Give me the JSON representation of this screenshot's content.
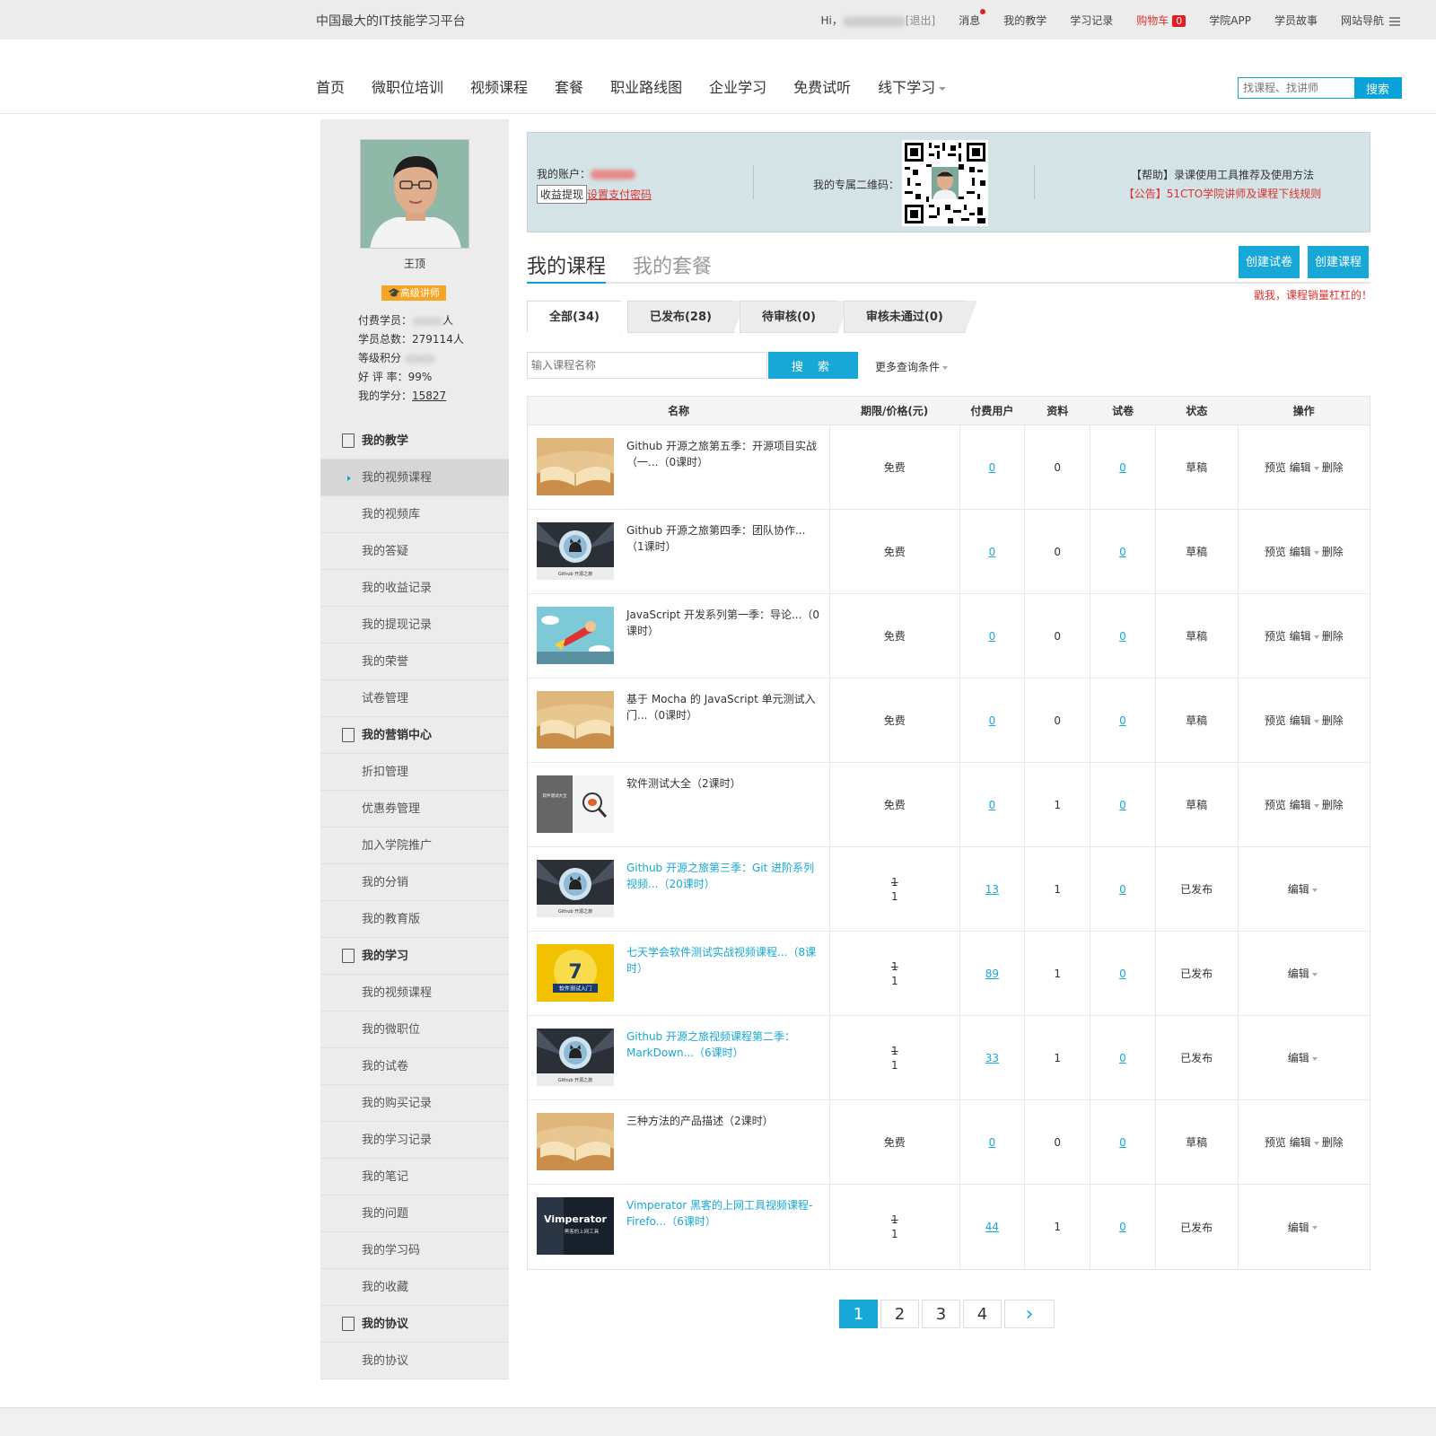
{
  "topbar": {
    "slogan": "中国最大的IT技能学习平台",
    "greeting": "Hi，",
    "logout": "[退出]",
    "links": [
      "消息",
      "我的教学",
      "学习记录"
    ],
    "cart_label": "购物车",
    "cart_count": "0",
    "links2": [
      "学院APP",
      "学员故事"
    ],
    "site_nav": "网站导航"
  },
  "nav": {
    "items": [
      "首页",
      "微职位培训",
      "视频课程",
      "套餐",
      "职业路线图",
      "企业学习",
      "免费试听",
      "线下学习"
    ],
    "search_placeholder": "找课程、找讲师",
    "search_button": "搜索"
  },
  "profile": {
    "name": "王顶",
    "level": "高级讲师",
    "paid_students_label": "付费学员：",
    "paid_students_suffix": "人",
    "total_students_label": "学员总数：",
    "total_students": "279114人",
    "points_label": "等级积分",
    "rating_label": "好 评 率：",
    "rating": "99%",
    "credits_label": "我的学分：",
    "credits": "15827"
  },
  "sidebar": {
    "sections": [
      {
        "title": "我的教学",
        "icon": "book-icon",
        "items": [
          "我的视频课程",
          "我的视频库",
          "我的答疑",
          "我的收益记录",
          "我的提现记录",
          "我的荣誉",
          "试卷管理"
        ]
      },
      {
        "title": "我的营销中心",
        "icon": "sale-tag-icon",
        "items": [
          "折扣管理",
          "优惠券管理",
          "加入学院推广",
          "我的分销",
          "我的教育版"
        ]
      },
      {
        "title": "我的学习",
        "icon": "clipboard-icon",
        "items": [
          "我的视频课程",
          "我的微职位",
          "我的试卷",
          "我的购买记录",
          "我的学习记录",
          "我的笔记",
          "我的问题",
          "我的学习码",
          "我的收藏"
        ]
      },
      {
        "title": "我的协议",
        "icon": "document-icon",
        "items": [
          "我的协议"
        ]
      }
    ]
  },
  "account": {
    "account_label": "我的账户：",
    "withdraw": "收益提现",
    "set_password": "设置支付密码",
    "qr_label": "我的专属二维码：",
    "help": "【帮助】录课使用工具推荐及使用方法",
    "notice": "【公告】51CTO学院讲师及课程下线规则"
  },
  "main": {
    "tabs": [
      "我的课程",
      "我的套餐"
    ],
    "create_exam": "创建试卷",
    "create_course": "创建课程",
    "promo": "戳我，课程销量杠杠的！",
    "subtabs": [
      "全部(34)",
      "已发布(28)",
      "待审核(0)",
      "审核未通过(0)"
    ],
    "search_placeholder": "输入课程名称",
    "search_button": "搜 索",
    "more": "更多查询条件"
  },
  "table": {
    "headers": [
      "名称",
      "期限/价格(元)",
      "付费用户",
      "资料",
      "试卷",
      "状态",
      "操作"
    ],
    "rows": [
      {
        "title": "Github 开源之旅第五季：开源项目实战（一...（0课时）",
        "thumb": "book",
        "published": false,
        "price": "免费",
        "paid": "0",
        "res": "0",
        "exam": "0",
        "status": "草稿"
      },
      {
        "title": "Github 开源之旅第四季：团队协作...（1课时）",
        "thumb": "github",
        "published": false,
        "price": "免费",
        "paid": "0",
        "res": "0",
        "exam": "0",
        "status": "草稿"
      },
      {
        "title": "JavaScript 开发系列第一季：导论...（0课时）",
        "thumb": "hero",
        "published": false,
        "price": "免费",
        "paid": "0",
        "res": "0",
        "exam": "0",
        "status": "草稿"
      },
      {
        "title": "基于 Mocha 的 JavaScript 单元测试入门...（0课时）",
        "thumb": "book",
        "published": false,
        "price": "免费",
        "paid": "0",
        "res": "0",
        "exam": "0",
        "status": "草稿"
      },
      {
        "title": "软件测试大全（2课时）",
        "thumb": "test",
        "published": false,
        "price": "免费",
        "paid": "0",
        "res": "1",
        "exam": "0",
        "status": "草稿"
      },
      {
        "title": "Github 开源之旅第三季：Git 进阶系列视频...（20课时）",
        "thumb": "github",
        "published": true,
        "price_old": "1",
        "price": "1",
        "paid": "13",
        "res": "1",
        "exam": "0",
        "status": "已发布"
      },
      {
        "title": "七天学会软件测试实战视频课程...（8课时）",
        "thumb": "seven",
        "published": true,
        "price_old": "1",
        "price": "1",
        "paid": "89",
        "res": "1",
        "exam": "0",
        "status": "已发布"
      },
      {
        "title": "Github 开源之旅视频课程第二季：MarkDown...（6课时）",
        "thumb": "github",
        "published": true,
        "price_old": "1",
        "price": "1",
        "paid": "33",
        "res": "1",
        "exam": "0",
        "status": "已发布"
      },
      {
        "title": "三种方法的产品描述（2课时）",
        "thumb": "book",
        "published": false,
        "price": "免费",
        "paid": "0",
        "res": "0",
        "exam": "0",
        "status": "草稿"
      },
      {
        "title": "Vimperator 黑客的上网工具视频课程-Firefo...（6课时）",
        "thumb": "vim",
        "published": true,
        "price_old": "1",
        "price": "1",
        "paid": "44",
        "res": "1",
        "exam": "0",
        "status": "已发布"
      }
    ],
    "ops": {
      "preview": "预览",
      "edit": "编辑",
      "delete": "删除"
    },
    "thumb_texts": {
      "github": "Github 开源之旅",
      "test": "软件测试大全",
      "seven_num": "7",
      "seven": "软件测试入门",
      "vim": "Vimperator",
      "vim_sub": "黑客的上网工具"
    }
  },
  "pager": {
    "pages": [
      "1",
      "2",
      "3",
      "4"
    ],
    "next": "›"
  },
  "colors": {
    "accent": "#17a8d8",
    "red": "#e03030",
    "sidebar": "#ececec"
  }
}
